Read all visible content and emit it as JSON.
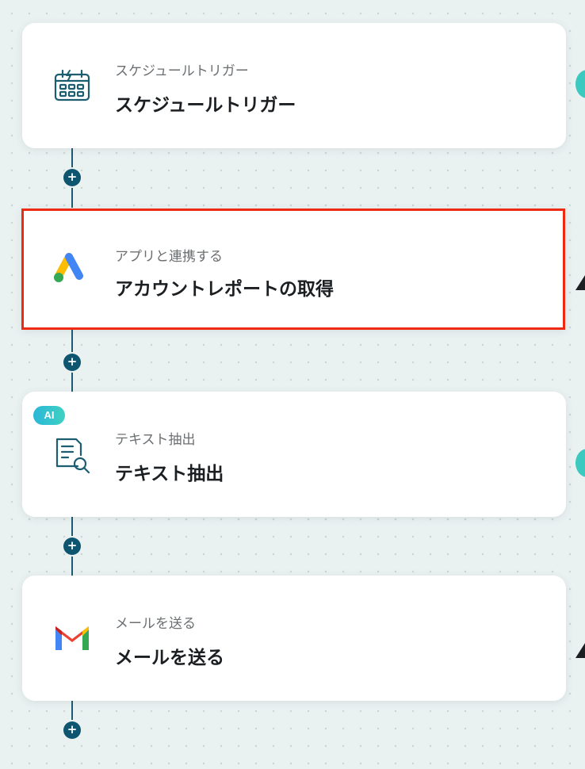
{
  "steps": [
    {
      "subtitle": "スケジュールトリガー",
      "title": "スケジュールトリガー",
      "icon": "calendar-schedule-icon"
    },
    {
      "subtitle": "アプリと連携する",
      "title": "アカウントレポートの取得",
      "icon": "google-ads-icon"
    },
    {
      "subtitle": "テキスト抽出",
      "title": "テキスト抽出",
      "icon": "document-search-icon",
      "badge": "AI"
    },
    {
      "subtitle": "メールを送る",
      "title": "メールを送る",
      "icon": "gmail-icon"
    }
  ],
  "add_step_label": "+",
  "colors": {
    "connector": "#1f5b70",
    "selection": "#ee2a12",
    "ai_badge": "#2ab7d8"
  }
}
